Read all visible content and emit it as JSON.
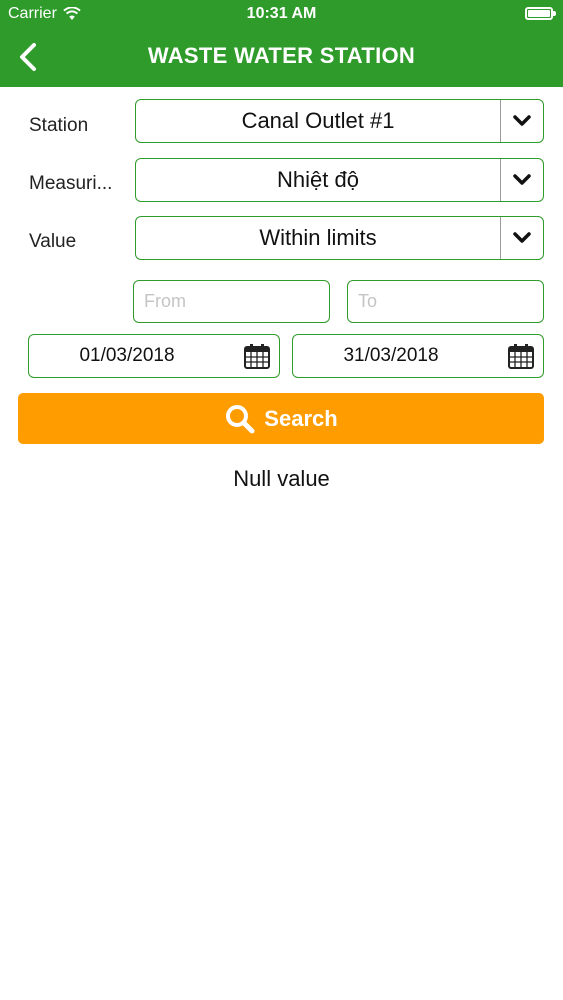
{
  "status_bar": {
    "carrier": "Carrier",
    "time": "10:31 AM",
    "wifi_icon": "wifi-icon",
    "battery_icon": "battery-icon"
  },
  "header": {
    "title": "WASTE WATER STATION",
    "back_icon": "chevron-left-icon",
    "background_color": "#2e9b2a"
  },
  "form": {
    "station": {
      "label": "Station",
      "value": "Canal Outlet #1"
    },
    "measuring": {
      "label": "Measuri...",
      "value": "Nhiệt độ"
    },
    "value_filter": {
      "label": "Value",
      "value": "Within limits"
    },
    "from_input": {
      "placeholder": "From",
      "value": ""
    },
    "to_input": {
      "placeholder": "To",
      "value": ""
    },
    "start_date": "01/03/2018",
    "end_date": "31/03/2018",
    "border_color": "#2e9b2a"
  },
  "search_button": {
    "label": "Search",
    "icon": "search-icon",
    "color": "#ff9c00"
  },
  "result": {
    "message": "Null value"
  }
}
